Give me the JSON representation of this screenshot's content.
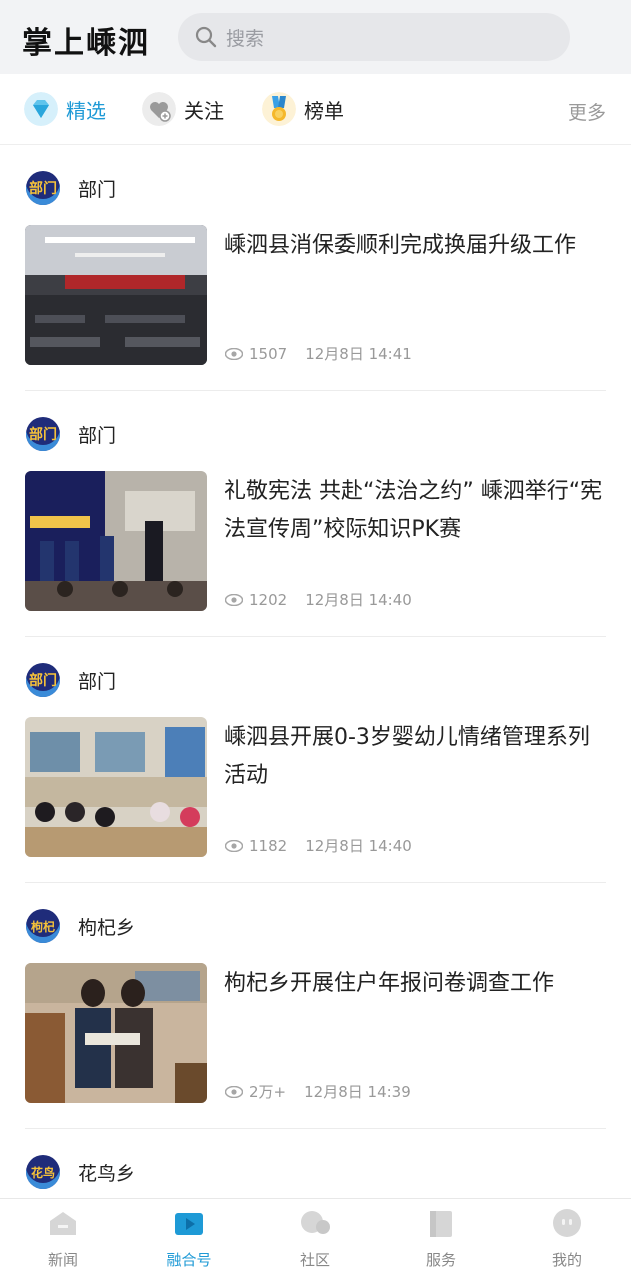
{
  "header": {
    "logo": "掌上嵊泗",
    "search_placeholder": "搜索"
  },
  "tabs": [
    {
      "label": "精选",
      "icon": "diamond-icon",
      "active": true
    },
    {
      "label": "关注",
      "icon": "follow-heart-icon",
      "active": false
    },
    {
      "label": "榜单",
      "icon": "medal-icon",
      "active": false
    }
  ],
  "more_label": "更多",
  "feed": [
    {
      "source_badge": "部门",
      "source": "部门",
      "title": "嵊泗县消保委顺利完成换届升级工作",
      "views": "1507",
      "time": "12月8日 14:41"
    },
    {
      "source_badge": "部门",
      "source": "部门",
      "title": "礼敬宪法 共赴“法治之约” 嵊泗举行“宪法宣传周”校际知识PK赛",
      "views": "1202",
      "time": "12月8日 14:40"
    },
    {
      "source_badge": "部门",
      "source": "部门",
      "title": "嵊泗县开展0-3岁婴幼儿情绪管理系列活动",
      "views": "1182",
      "time": "12月8日 14:40"
    },
    {
      "source_badge": "枸杞",
      "source": "枸杞乡",
      "title": "枸杞乡开展住户年报问卷调查工作",
      "views": "2万+",
      "time": "12月8日 14:39"
    },
    {
      "source_badge": "花鸟",
      "source": "花鸟乡"
    }
  ],
  "bottom_nav": [
    {
      "label": "新闻",
      "icon": "news-home-icon"
    },
    {
      "label": "融合号",
      "icon": "video-camera-icon",
      "active": true
    },
    {
      "label": "社区",
      "icon": "community-bubble-icon"
    },
    {
      "label": "服务",
      "icon": "service-book-icon"
    },
    {
      "label": "我的",
      "icon": "profile-face-icon"
    }
  ]
}
